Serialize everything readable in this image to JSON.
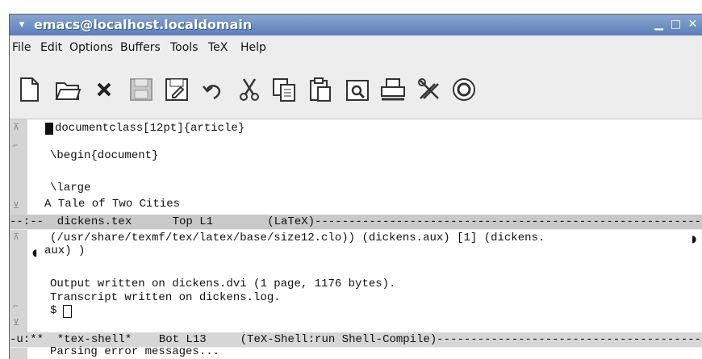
{
  "window": {
    "title": "emacs@localhost.localdomain",
    "menu_glyph": "▾",
    "minimize": "▁",
    "maximize": "□",
    "close": "✕"
  },
  "menubar": [
    "File",
    "Edit",
    "Options",
    "Buffers",
    "Tools",
    "TeX",
    "Help"
  ],
  "toolbar": [
    "new-file-icon",
    "open-folder-icon",
    "close-buffer-icon",
    "save-icon",
    "save-as-icon",
    "undo-icon",
    "cut-icon",
    "copy-icon",
    "paste-icon",
    "search-icon",
    "print-icon",
    "preferences-icon",
    "help-icon"
  ],
  "upper_buffer": {
    "lines": [
      "documentclass[12pt]{article}",
      "",
      "\\begin{document}",
      "",
      "\\large",
      "A Tale of Two Cities"
    ],
    "modeline": "--:--  dickens.tex      Top L1        (LaTeX)----------------------------------------------------------"
  },
  "lower_buffer": {
    "lines": [
      "(/usr/share/texmf/tex/latex/base/size12.clo)) (dickens.aux) [1] (dickens.",
      "aux) )",
      "",
      "Output written on dickens.dvi (1 page, 1176 bytes).",
      "Transcript written on dickens.log.",
      "$ "
    ],
    "modeline": "-u:**  *tex-shell*    Bot L13     (TeX-Shell:run Shell-Compile)---------------------------------------"
  },
  "minibuffer": "Parsing error messages...",
  "colors": {
    "titlebar": "#6d8fc4",
    "modeline": "#c9c9c9",
    "background": "#ededed"
  }
}
